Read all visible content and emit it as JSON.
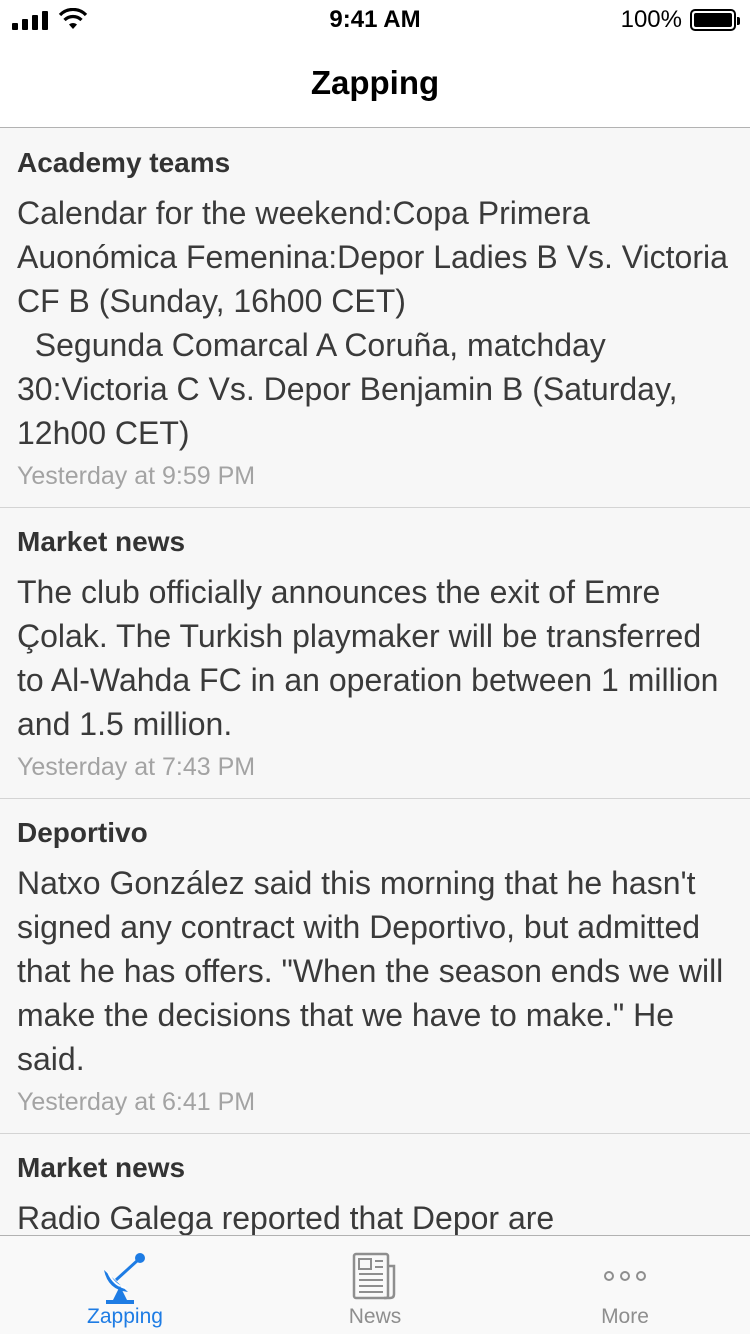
{
  "status_bar": {
    "time": "9:41 AM",
    "battery": "100%"
  },
  "header": {
    "title": "Zapping"
  },
  "feed": [
    {
      "category": "Academy teams",
      "body": "Calendar for the weekend:Copa Primera Auonómica Femenina:Depor Ladies B Vs. Victoria CF B (Sunday, 16h00 CET)\n  Segunda Comarcal A Coruña, matchday 30:Victoria C Vs. Depor Benjamin B (Saturday, 12h00 CET)",
      "time": "Yesterday at 9:59 PM"
    },
    {
      "category": "Market news",
      "body": "The club officially announces the exit of Emre Çolak. The Turkish playmaker will be transferred to Al-Wahda FC in an operation between 1 million and 1.5 million.",
      "time": "Yesterday at 7:43 PM"
    },
    {
      "category": "Deportivo",
      "body": "Natxo González said this morning that he hasn't signed any contract with Deportivo, but admitted that he has offers. \"When the season ends we will make the decisions that we have to make.\" He said.",
      "time": "Yesterday at 6:41 PM"
    },
    {
      "category": "Market news",
      "body": "Radio Galega reported that Depor are",
      "time": ""
    }
  ],
  "tab_bar": {
    "tabs": [
      {
        "label": "Zapping",
        "icon": "satellite-dish-icon",
        "active": true
      },
      {
        "label": "News",
        "icon": "newspaper-icon",
        "active": false
      },
      {
        "label": "More",
        "icon": "more-dots-icon",
        "active": false
      }
    ],
    "active_color": "#1e7ce4",
    "inactive_color": "#8e8e8e"
  }
}
